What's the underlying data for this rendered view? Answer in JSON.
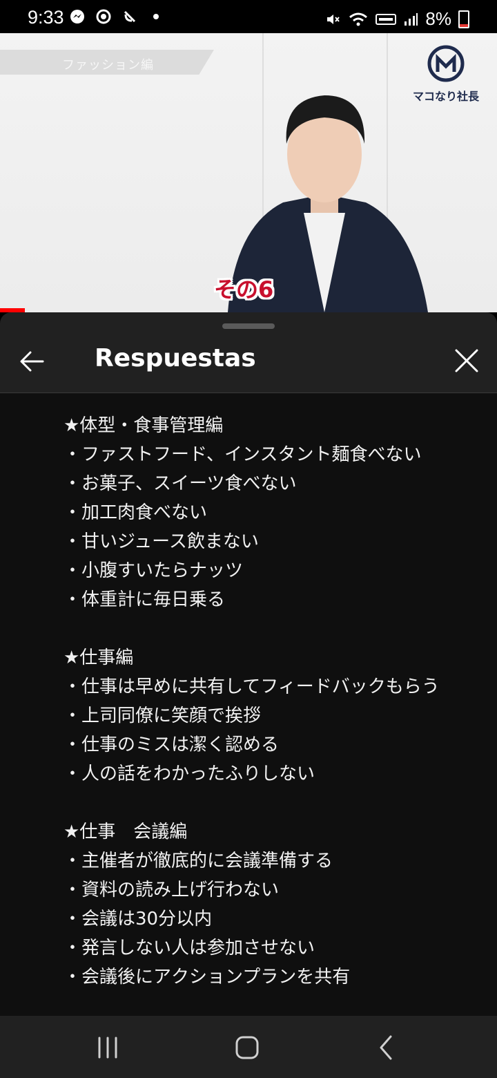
{
  "status_bar": {
    "time": "9:33",
    "battery": "8%",
    "icons_left": [
      "messenger-icon",
      "sync-icon",
      "missed-call-icon",
      "notification-dot-icon"
    ],
    "icons_right": [
      "mute-icon",
      "wifi-icon",
      "volte-icon",
      "signal-icon",
      "battery-icon"
    ]
  },
  "video": {
    "banner_text": "ファッション編",
    "logo_text": "マコなり社長",
    "caption": "その6",
    "progress_fraction": 0.05
  },
  "sheet": {
    "title": "Respuestas",
    "back_icon": "arrow-left-icon",
    "close_icon": "close-icon",
    "sections": [
      {
        "heading": "★体型・食事管理編",
        "items": [
          "・ファストフード、インスタント麺食べない",
          "・お菓子、スイーツ食べない",
          "・加工肉食べない",
          "・甘いジュース飲まない",
          "・小腹すいたらナッツ",
          "・体重計に毎日乗る"
        ]
      },
      {
        "heading": "★仕事編",
        "items": [
          "・仕事は早めに共有してフィードバックもらう",
          "・上司同僚に笑顔で挨拶",
          "・仕事のミスは潔く認める",
          "・人の話をわかったふりしない"
        ]
      },
      {
        "heading": "★仕事　会議編",
        "items": [
          "・主催者が徹底的に会議準備する",
          "・資料の読み上げ行わない",
          "・会議は30分以内",
          "・発言しない人は参加させない",
          "・会議後にアクションプランを共有"
        ]
      }
    ]
  },
  "nav_bar": {
    "buttons": [
      "recent-apps-icon",
      "home-icon",
      "back-icon"
    ]
  },
  "colors": {
    "sheet_bg": "#212121",
    "content_bg": "#0f0f0f",
    "progress": "#ff0000",
    "caption": "#c8102e",
    "logo": "#1f2b4d"
  }
}
